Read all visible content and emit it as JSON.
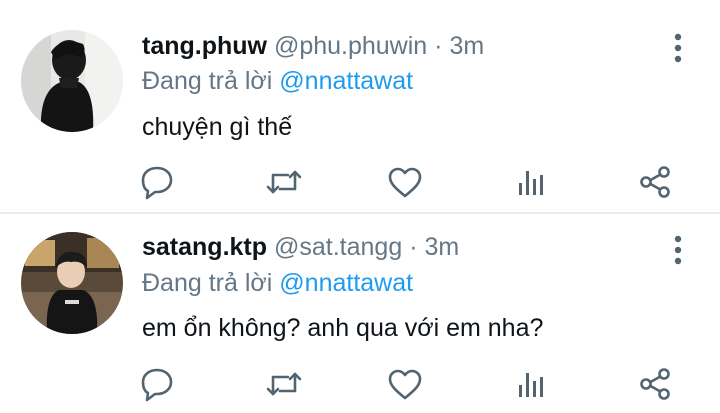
{
  "reply_prefix": "Đang trả lời",
  "colors": {
    "accent": "#1d9bf0",
    "secondary_text": "#657786",
    "icon": "#536471",
    "divider": "#e6ecf0"
  },
  "tweets": [
    {
      "display_name": "tang.phuw",
      "handle": "@phu.phuwin",
      "separator": "·",
      "time": "3m",
      "reply_to": "@nnattawat",
      "text": "chuyện gì thế"
    },
    {
      "display_name": "satang.ktp",
      "handle": "@sat.tangg",
      "separator": "·",
      "time": "3m",
      "reply_to": "@nnattawat",
      "text": "em ổn không? anh qua với em nha?"
    }
  ],
  "icons": [
    "more-vertical-icon",
    "reply-icon",
    "retweet-icon",
    "like-icon",
    "stats-icon",
    "share-icon"
  ]
}
